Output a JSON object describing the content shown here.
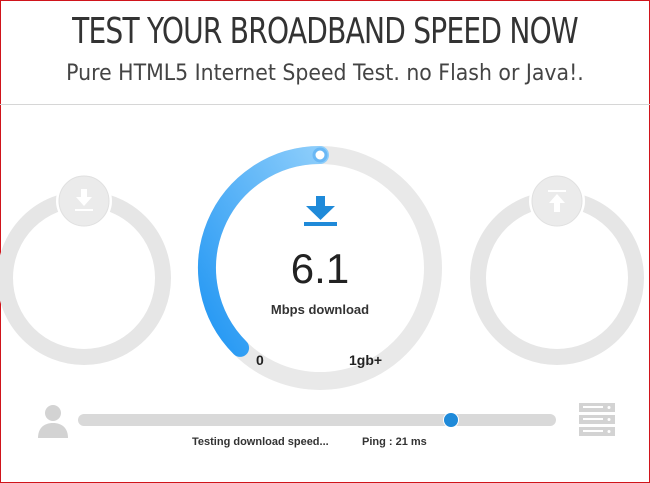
{
  "header": {
    "title": "TEST YOUR BROADBAND SPEED NOW",
    "subtitle": "Pure HTML5 Internet Speed Test. no Flash or Java!."
  },
  "gauge": {
    "value": "6.1",
    "unit_label": "Mbps download",
    "min_label": "0",
    "max_label": "1gb+",
    "fill_fraction": 0.5
  },
  "progress": {
    "fraction": 0.78,
    "status_text": "Testing download speed...",
    "ping_text": "Ping : 21 ms"
  },
  "icons": {
    "left_gauge": "download-arrow-icon",
    "center_gauge": "download-arrow-icon",
    "right_gauge": "upload-arrow-icon",
    "client": "user-icon",
    "server": "server-icon"
  },
  "colors": {
    "accent_blue": "#2196f3",
    "accent_light_blue": "#6ab8f5",
    "track_gray": "#e6e6e6",
    "border_red": "#d0141b"
  }
}
